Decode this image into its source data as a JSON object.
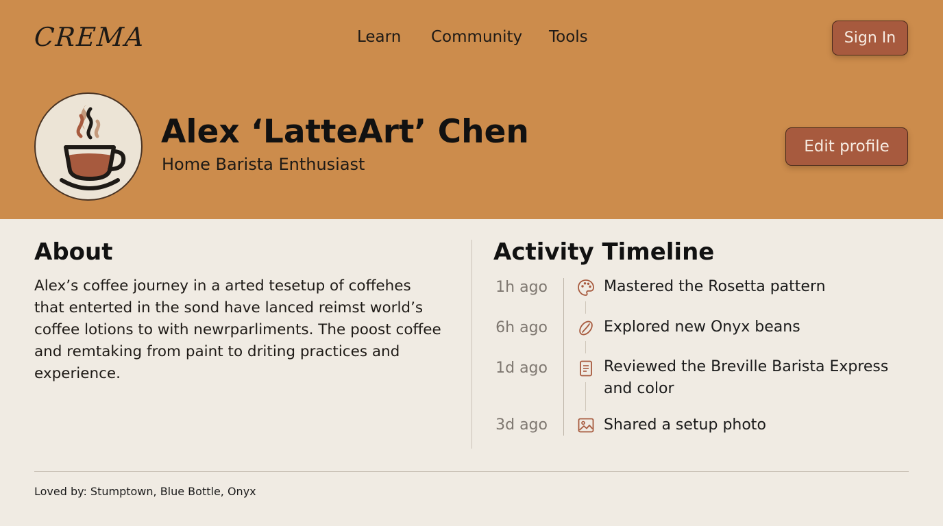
{
  "brand": {
    "logo_text": "CREMA"
  },
  "nav": {
    "links": [
      {
        "label": "Learn"
      },
      {
        "label": "Community"
      },
      {
        "label": "Tools"
      }
    ],
    "sign_in_label": "Sign In"
  },
  "profile": {
    "avatar_icon": "coffee-cup-icon",
    "name": "Alex ‘LatteArt’ Chen",
    "subtitle": "Home Barista Enthusiast",
    "edit_label": "Edit profile"
  },
  "about": {
    "title": "About",
    "text": "Alex’s coffee journey in a arted tesetup of coffehes that enterted in the sond have lanced reimst world’s coffee lotions to with newrparliments. The poost coffee and remtaking from paint to driting practices and experience."
  },
  "activity": {
    "title": "Activity Timeline",
    "items": [
      {
        "time": "1h ago",
        "icon": "palette-icon",
        "text": "Mastered the Rosetta pattern"
      },
      {
        "time": "6h ago",
        "icon": "coffee-bean-icon",
        "text": "Explored new Onyx beans"
      },
      {
        "time": "1d ago",
        "icon": "document-icon",
        "text": "Reviewed the Breville Barista Express and color"
      },
      {
        "time": "3d ago",
        "icon": "image-icon",
        "text": "Shared a setup photo"
      }
    ]
  },
  "footer": {
    "text": "Loved by: Stumptown, Blue Bottle, Onyx"
  },
  "colors": {
    "header_bg": "#cc8c4c",
    "page_bg": "#f0ebe3",
    "button_bg": "#a75a3e",
    "icon_accent": "#a75a3e"
  }
}
